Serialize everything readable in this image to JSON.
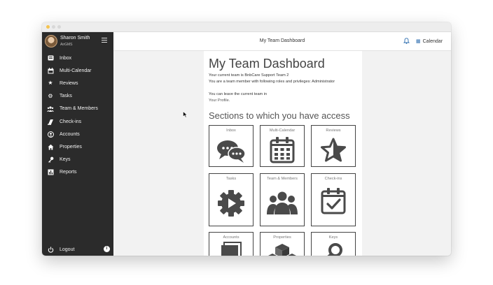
{
  "topbar": {
    "title": "My Team Dashboard",
    "calendar_label": "Calendar"
  },
  "user": {
    "name": "Sharon Smith",
    "org": "AirGMS"
  },
  "sidebar": {
    "items": [
      {
        "label": "Inbox",
        "icon": "inbox-icon"
      },
      {
        "label": "Multi-Calendar",
        "icon": "calendar-icon"
      },
      {
        "label": "Reviews",
        "icon": "star-icon"
      },
      {
        "label": "Tasks",
        "icon": "gear-icon"
      },
      {
        "label": "Team & Members",
        "icon": "users-icon"
      },
      {
        "label": "Check-ins",
        "icon": "checkin-icon"
      },
      {
        "label": "Accounts",
        "icon": "account-icon"
      },
      {
        "label": "Properties",
        "icon": "home-icon"
      },
      {
        "label": "Keys",
        "icon": "key-icon"
      },
      {
        "label": "Reports",
        "icon": "chart-icon"
      }
    ],
    "logout": "Logout"
  },
  "main": {
    "title": "My Team Dashboard",
    "line1": "Your current team is BnbCare Support Team 2",
    "line2": "You are a team member with following roles and privileges: Administrator",
    "line3": "You can leave the current team in",
    "line4": "Your Profile.",
    "sections_title": "Sections to which you have access",
    "tiles": [
      {
        "label": "Inbox",
        "icon": "chat-bubbles-icon"
      },
      {
        "label": "Multi-Calendar",
        "icon": "calendar-grid-icon"
      },
      {
        "label": "Reviews",
        "icon": "star-outline-icon"
      },
      {
        "label": "Tasks",
        "icon": "gear-play-icon"
      },
      {
        "label": "Team & Members",
        "icon": "group-icon"
      },
      {
        "label": "Check-ins",
        "icon": "calendar-check-icon"
      },
      {
        "label": "Accounts",
        "icon": "accounts-stack-icon"
      },
      {
        "label": "Properties",
        "icon": "cubes-icon"
      },
      {
        "label": "Keys",
        "icon": "key-outline-icon"
      }
    ]
  }
}
